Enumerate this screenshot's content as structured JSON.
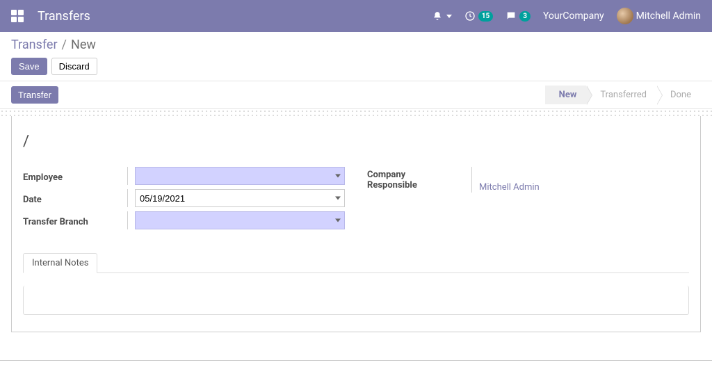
{
  "navbar": {
    "app_title": "Transfers",
    "activities_count": "15",
    "discuss_count": "3",
    "company": "YourCompany",
    "user_name": "Mitchell Admin"
  },
  "breadcrumb": {
    "root": "Transfer",
    "sep": "/",
    "current": "New"
  },
  "buttons": {
    "save": "Save",
    "discard": "Discard",
    "transfer": "Transfer"
  },
  "status": {
    "new": "New",
    "transferred": "Transferred",
    "done": "Done"
  },
  "form": {
    "record_title": "/",
    "left": {
      "employee_label": "Employee",
      "employee_value": "",
      "date_label": "Date",
      "date_value": "05/19/2021",
      "branch_label": "Transfer Branch",
      "branch_value": ""
    },
    "right": {
      "company_label": "Company",
      "company_value": "",
      "responsible_label": "Responsible",
      "responsible_value": "Mitchell Admin"
    }
  },
  "tabs": {
    "internal_notes": "Internal Notes"
  }
}
